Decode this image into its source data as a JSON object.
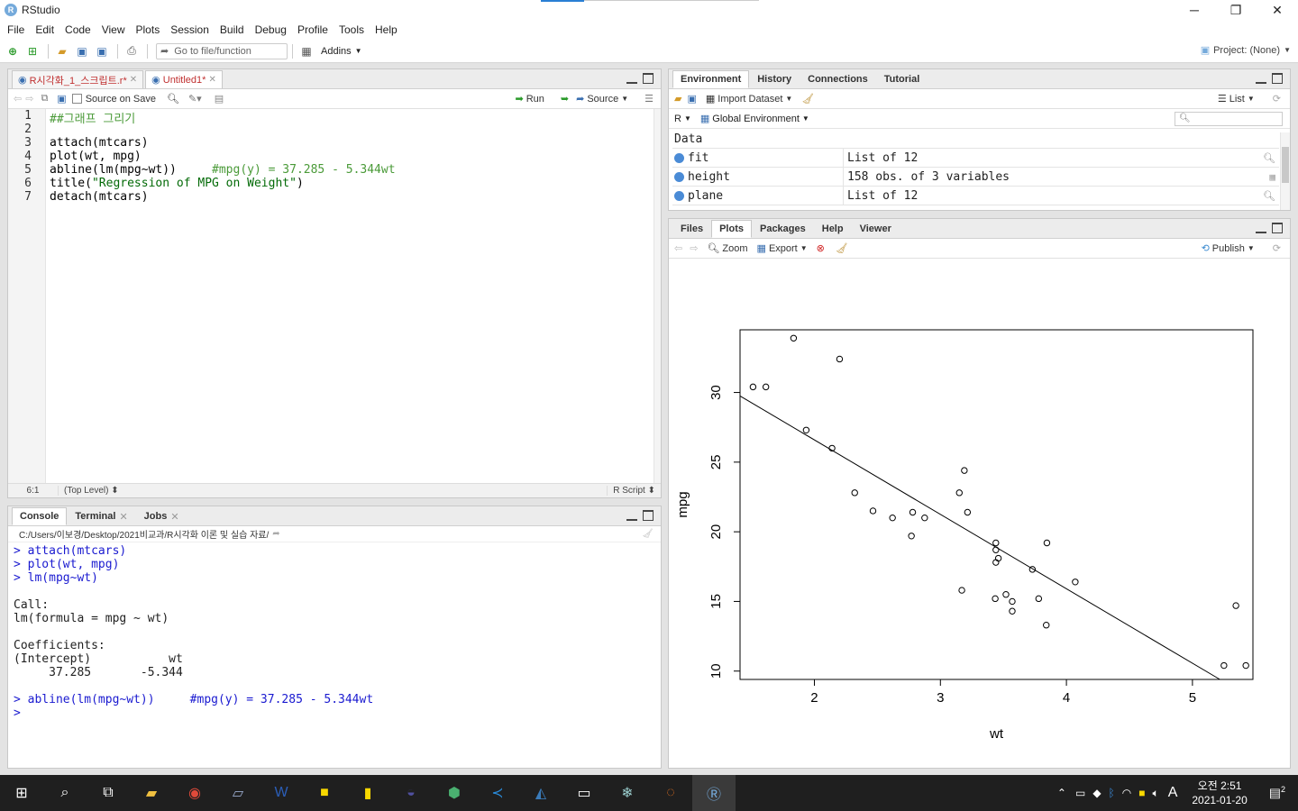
{
  "window": {
    "title": "RStudio",
    "min": "─",
    "max": "❐",
    "close": "✕"
  },
  "menu": [
    "File",
    "Edit",
    "Code",
    "View",
    "Plots",
    "Session",
    "Build",
    "Debug",
    "Profile",
    "Tools",
    "Help"
  ],
  "toolbar": {
    "goto_placeholder": "Go to file/function",
    "addins": "Addins",
    "project": "Project: (None)"
  },
  "editor": {
    "tabs": [
      {
        "label": "R시각화_1_스크립트.r*"
      },
      {
        "label": "Untitled1*"
      }
    ],
    "source_on_save": "Source on Save",
    "run": "Run",
    "source": "Source",
    "lines": [
      {
        "no": "1",
        "text": "##그래프 그리기"
      },
      {
        "no": "2",
        "text": ""
      },
      {
        "no": "3",
        "text": "attach(mtcars)"
      },
      {
        "no": "4",
        "text": "plot(wt, mpg)"
      },
      {
        "no": "5",
        "text": "abline(lm(mpg~wt))",
        "comment": "#mpg(y) = 37.285 - 5.344wt"
      },
      {
        "no": "6",
        "text": "title(",
        "string": "\"Regression of MPG on Weight\"",
        "tail": ")"
      },
      {
        "no": "7",
        "text": "detach(mtcars)"
      }
    ],
    "status_pos": "6:1",
    "status_scope": "(Top Level)",
    "status_type": "R Script"
  },
  "console": {
    "tabs": [
      {
        "label": "Console"
      },
      {
        "label": "Terminal"
      },
      {
        "label": "Jobs"
      }
    ],
    "path": "C:/Users/이보경/Desktop/2021비교과/R시각화 이론 및 실습 자료/",
    "lines": [
      "> attach(mtcars)",
      "> plot(wt, mpg)",
      "> lm(mpg~wt)",
      "",
      "Call:",
      "lm(formula = mpg ~ wt)",
      "",
      "Coefficients:",
      "(Intercept)           wt  ",
      "     37.285       -5.344  ",
      "",
      "> abline(lm(mpg~wt))     #mpg(y) = 37.285 - 5.344wt",
      "> "
    ]
  },
  "environment": {
    "tabs": [
      {
        "label": "Environment"
      },
      {
        "label": "History"
      },
      {
        "label": "Connections"
      },
      {
        "label": "Tutorial"
      }
    ],
    "import": "Import Dataset",
    "list": "List",
    "lang": "R",
    "scope": "Global Environment",
    "section": "Data",
    "rows": [
      {
        "name": "fit",
        "value": "List of  12"
      },
      {
        "name": "height",
        "value": "158 obs. of 3 variables"
      },
      {
        "name": "plane",
        "value": "List of  12"
      }
    ]
  },
  "plots": {
    "tabs": [
      {
        "label": "Files"
      },
      {
        "label": "Plots"
      },
      {
        "label": "Packages"
      },
      {
        "label": "Help"
      },
      {
        "label": "Viewer"
      }
    ],
    "zoom": "Zoom",
    "export": "Export",
    "publish": "Publish"
  },
  "chart_data": {
    "type": "scatter",
    "title": "",
    "xlabel": "wt",
    "ylabel": "mpg",
    "xlim": [
      1.41,
      5.48
    ],
    "ylim": [
      9.4,
      34.5
    ],
    "xticks": [
      2,
      3,
      4,
      5
    ],
    "yticks": [
      10,
      15,
      20,
      25,
      30
    ],
    "grid": false,
    "points": [
      [
        2.62,
        21.0
      ],
      [
        2.875,
        21.0
      ],
      [
        2.32,
        22.8
      ],
      [
        3.215,
        21.4
      ],
      [
        3.44,
        18.7
      ],
      [
        3.46,
        18.1
      ],
      [
        3.57,
        14.3
      ],
      [
        3.19,
        24.4
      ],
      [
        3.15,
        22.8
      ],
      [
        3.44,
        19.2
      ],
      [
        3.44,
        17.8
      ],
      [
        4.07,
        16.4
      ],
      [
        3.73,
        17.3
      ],
      [
        3.78,
        15.2
      ],
      [
        5.25,
        10.4
      ],
      [
        5.424,
        10.4
      ],
      [
        5.345,
        14.7
      ],
      [
        2.2,
        32.4
      ],
      [
        1.615,
        30.4
      ],
      [
        1.835,
        33.9
      ],
      [
        2.465,
        21.5
      ],
      [
        3.52,
        15.5
      ],
      [
        3.435,
        15.2
      ],
      [
        3.84,
        13.3
      ],
      [
        3.845,
        19.2
      ],
      [
        1.935,
        27.3
      ],
      [
        2.14,
        26.0
      ],
      [
        1.513,
        30.4
      ],
      [
        3.17,
        15.8
      ],
      [
        2.77,
        19.7
      ],
      [
        3.57,
        15.0
      ],
      [
        2.78,
        21.4
      ]
    ],
    "regression": {
      "intercept": 37.285,
      "slope": -5.344
    }
  },
  "taskbar": {
    "time": "오전 2:51",
    "date": "2021-01-20",
    "lang": "A",
    "notif": "2"
  }
}
